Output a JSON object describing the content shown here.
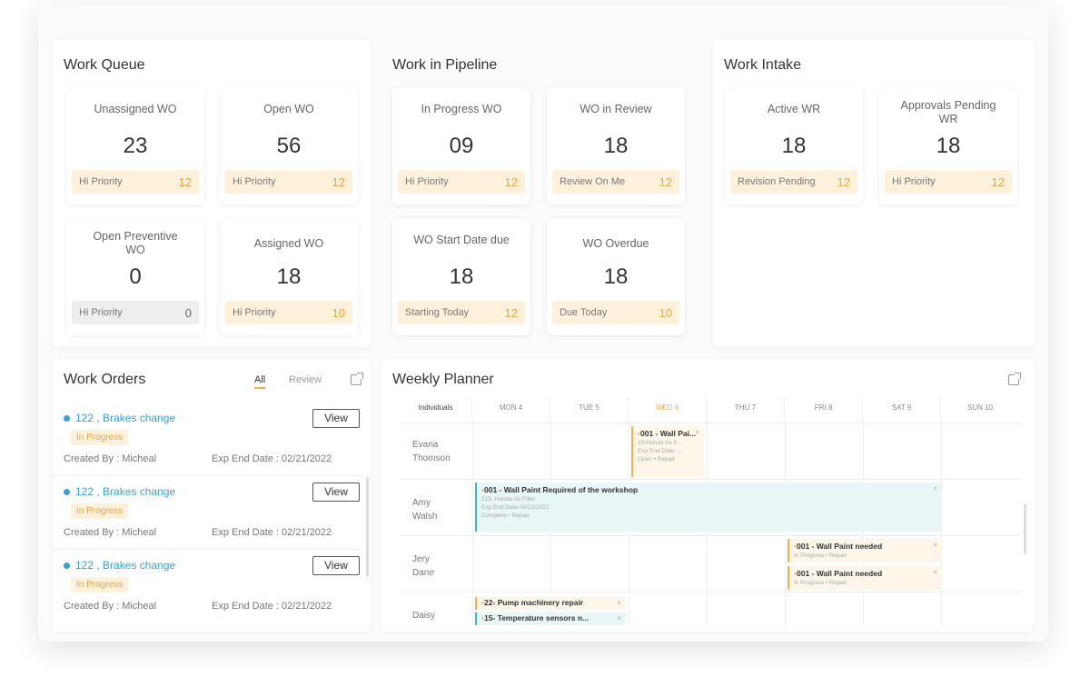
{
  "work_queue": {
    "title": "Work Queue",
    "cards": [
      {
        "label": "Unassigned WO",
        "value": "23",
        "foot_label": "Hi Priority",
        "foot_count": "12"
      },
      {
        "label": "Open WO",
        "value": "56",
        "foot_label": "Hi Priority",
        "foot_count": "12"
      },
      {
        "label": "Open Preventive WO",
        "value": "0",
        "foot_label": "Hi Priority",
        "foot_count": "0"
      },
      {
        "label": "Assigned WO",
        "value": "18",
        "foot_label": "Hi Priority",
        "foot_count": "10"
      }
    ]
  },
  "pipeline": {
    "title": "Work in Pipeline",
    "cards": [
      {
        "label": "In Progress WO",
        "value": "09",
        "foot_label": "Hi Priority",
        "foot_count": "12"
      },
      {
        "label": "WO in Review",
        "value": "18",
        "foot_label": "Review On Me",
        "foot_count": "12"
      },
      {
        "label": "WO Start Date due",
        "value": "18",
        "foot_label": "Starting Today",
        "foot_count": "12"
      },
      {
        "label": "WO Overdue",
        "value": "18",
        "foot_label": "Due Today",
        "foot_count": "10"
      }
    ]
  },
  "intake": {
    "title": "Work Intake",
    "cards": [
      {
        "label": "Active WR",
        "value": "18",
        "foot_label": "Revision Pending",
        "foot_count": "12"
      },
      {
        "label": "Approvals Pending WR",
        "value": "18",
        "foot_label": "Hi Priority",
        "foot_count": "12"
      }
    ]
  },
  "work_orders": {
    "title": "Work Orders",
    "tabs": [
      "All",
      "Review"
    ],
    "view_label": "View",
    "items": [
      {
        "title": "122 , Brakes change",
        "status": "In Progress",
        "created_by": "Created By : Micheal",
        "end_date": "Exp End Date : 02/21/2022"
      },
      {
        "title": "122 , Brakes change",
        "status": "In Progress",
        "created_by": "Created By : Micheal",
        "end_date": "Exp End Date : 02/21/2022"
      },
      {
        "title": "122 , Brakes change",
        "status": "In Progress",
        "created_by": "Created By : Micheal",
        "end_date": "Exp End Date : 02/21/2022"
      }
    ]
  },
  "planner": {
    "title": "Weekly Planner",
    "columns": [
      "Individuals",
      "MON 4",
      "TUE 5",
      "WED 6",
      "THU 7",
      "FRI 8",
      "SAT 9",
      "SUN 10"
    ],
    "rows": [
      "Evana Thomson",
      "Amy Walsh",
      "Jery Dane",
      "Daisy"
    ],
    "events": [
      {
        "title": "001 - Wall Pai...",
        "sub": "33-Honda Air fi...",
        "meta": "Exp End Date: ...",
        "tags": "Open • Repair"
      },
      {
        "title": "001 - Wall Paint Required of the workshop",
        "sub": "215- Honda Air Filter",
        "meta": "Exp End Date 06/13/2022",
        "tags": "Complete • Repair"
      },
      {
        "title": "001 - Wall Paint needed",
        "tags": "In Progress • Repair"
      },
      {
        "title": "001 - Wall Paint needed",
        "tags": "In Progress • Repair"
      },
      {
        "title": "22- Pump machinery repair"
      },
      {
        "title": "15- Temperature sensors n..."
      }
    ]
  }
}
